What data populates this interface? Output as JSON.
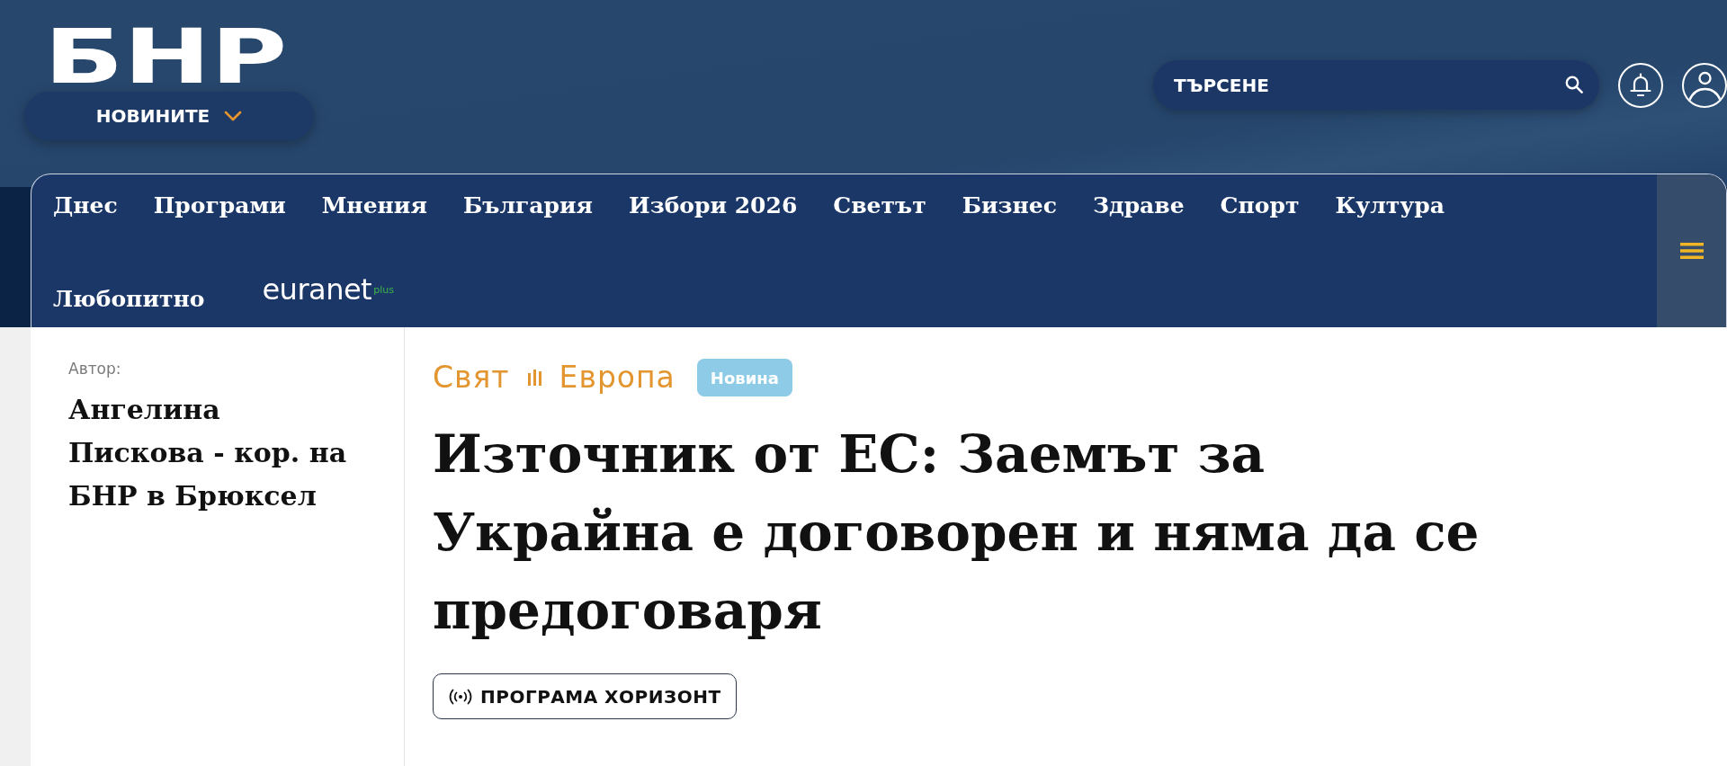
{
  "header": {
    "logo": "БНР",
    "section_menu": {
      "label": "НОВИНИТЕ",
      "expanded": false
    },
    "search": {
      "placeholder": "ТЪРСЕНЕ"
    }
  },
  "nav": {
    "items": [
      {
        "kind": "link",
        "label": "Днес"
      },
      {
        "kind": "link",
        "label": "Програми"
      },
      {
        "kind": "link",
        "label": "Мнения"
      },
      {
        "kind": "link",
        "label": "България"
      },
      {
        "kind": "link",
        "label": "Избори 2026"
      },
      {
        "kind": "link",
        "label": "Светът"
      },
      {
        "kind": "link",
        "label": "Бизнес"
      },
      {
        "kind": "link",
        "label": "Здраве"
      },
      {
        "kind": "link",
        "label": "Спорт"
      },
      {
        "kind": "link",
        "label": "Култура"
      },
      {
        "kind": "link",
        "label": "Любопитно"
      },
      {
        "kind": "partner",
        "label": "euranet$^{plus}$"
      }
    ]
  },
  "article": {
    "author_label": "Автор:",
    "author": "Ангелина Пискова - кор. на БНР в Брюксел",
    "breadcrumb": [
      "Свят",
      "Европа"
    ],
    "badge": "Новина",
    "title": "Източник от ЕС: Заемът за Украйна е договорен и няма да се предоговаря",
    "program": "ПРОГРАМА ХОРИЗОНТ"
  }
}
